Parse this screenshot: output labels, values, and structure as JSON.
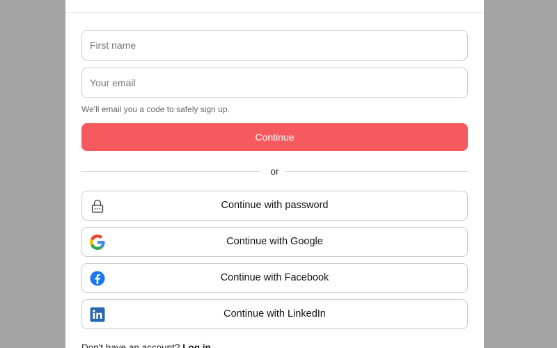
{
  "form": {
    "first_name_placeholder": "First name",
    "email_placeholder": "Your email",
    "hint": "We'll email you a code to safely sign up.",
    "continue_label": "Continue",
    "divider_text": "or"
  },
  "alt_options": [
    {
      "label": "Continue with password",
      "icon": "lock-icon"
    },
    {
      "label": "Continue with Google",
      "icon": "google-icon"
    },
    {
      "label": "Continue with Facebook",
      "icon": "facebook-icon"
    },
    {
      "label": "Continue with LinkedIn",
      "icon": "linkedin-icon"
    }
  ],
  "footer": {
    "prompt": "Don't have an account?",
    "login_label": "Log in"
  },
  "colors": {
    "backdrop": "#a3a3a3",
    "primary": "#f65a5f",
    "facebook": "#1877f2",
    "linkedin": "#2867b2"
  }
}
